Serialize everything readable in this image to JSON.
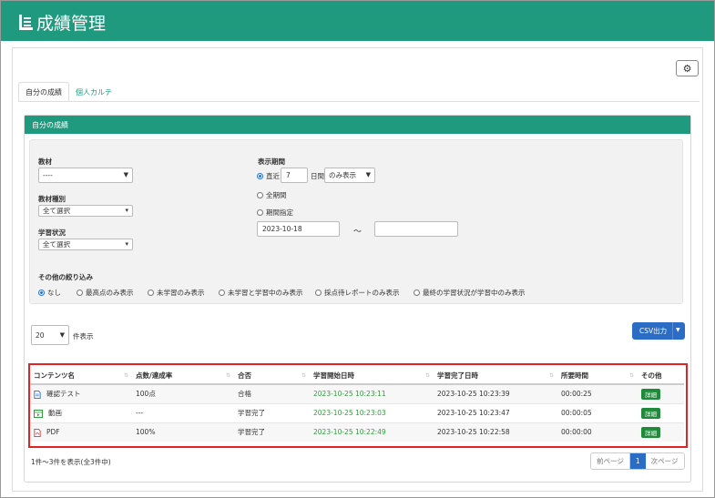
{
  "header": {
    "title": "成績管理",
    "brand_color": "#1f9a7e"
  },
  "toolbar": {
    "settings_icon": "gear-icon",
    "settings_glyph": "⚙"
  },
  "tabs": [
    {
      "label": "自分の成績",
      "active": true
    },
    {
      "label": "個人カルテ",
      "active": false
    }
  ],
  "panel": {
    "title": "自分の成績"
  },
  "filters": {
    "material": {
      "label": "教材",
      "value": "----"
    },
    "material_type": {
      "label": "教材種別",
      "value": "全て選択"
    },
    "study_status": {
      "label": "学習状況",
      "value": "全て選択"
    },
    "period": {
      "label": "表示期間",
      "recent_label": "直近",
      "recent_days": "7",
      "days_unit": "日間",
      "mode_value": "のみ表示",
      "all_label": "全期間",
      "specify_label": "期間指定",
      "from_date": "2023-10-18",
      "tilde": "～",
      "to_date": "",
      "selected": "recent"
    },
    "narrow": {
      "label": "その他の絞り込み",
      "options": [
        "なし",
        "最高点のみ表示",
        "未学習のみ表示",
        "未学習と学習中のみ表示",
        "採点待レポートのみ表示",
        "最終の学習状況が学習中のみ表示"
      ],
      "selected": "なし"
    }
  },
  "list_controls": {
    "per_page": "20",
    "per_page_suffix": "件表示",
    "csv_label": "CSV出力"
  },
  "table": {
    "columns": [
      "コンテンツ名",
      "点数/達成率",
      "合否",
      "学習開始日時",
      "学習完了日時",
      "所要時間",
      "その他"
    ],
    "rows": [
      {
        "icon": "document-icon",
        "name": "確認テスト",
        "score": "100点",
        "result": "合格",
        "start": "2023-10-25 10:23:11",
        "end": "2023-10-25 10:23:39",
        "duration": "00:00:25",
        "action": "詳細"
      },
      {
        "icon": "video-icon",
        "name": "動画",
        "score": "---",
        "result": "学習完了",
        "start": "2023-10-25 10:23:03",
        "end": "2023-10-25 10:23:47",
        "duration": "00:00:05",
        "action": "詳細"
      },
      {
        "icon": "pdf-icon",
        "name": "PDF",
        "score": "100%",
        "result": "学習完了",
        "start": "2023-10-25 10:22:49",
        "end": "2023-10-25 10:22:58",
        "duration": "00:00:00",
        "action": "詳細"
      }
    ]
  },
  "footer": {
    "summary": "1件～3件を表示(全3件中)",
    "prev_label": "前ページ",
    "current_page": "1",
    "next_label": "次ページ"
  }
}
